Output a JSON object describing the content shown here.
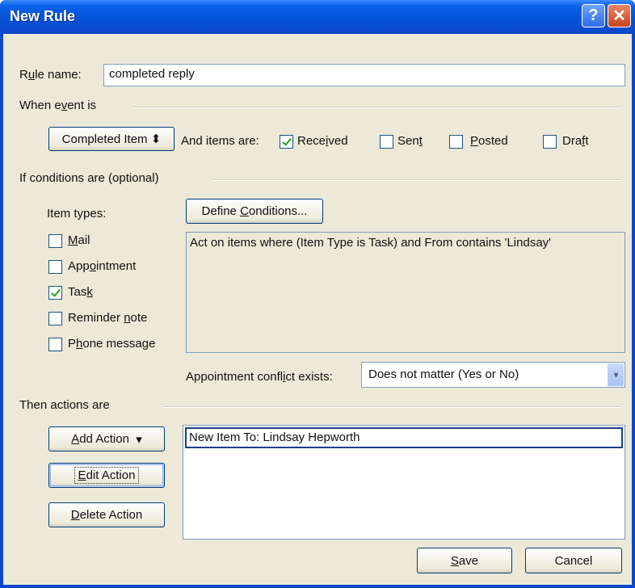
{
  "window": {
    "title": "New Rule",
    "help_glyph": "?",
    "close_glyph": "✕"
  },
  "rule_name": {
    "label_prefix": "R",
    "label_u": "u",
    "label_rest": "le name:",
    "value": "completed reply"
  },
  "when_event": {
    "heading_a": "When e",
    "heading_u": "v",
    "heading_b": "ent is",
    "event_value": "Completed Item",
    "event_arrow": "⬍",
    "and_items_label": "And items are:",
    "checkboxes": [
      {
        "pre": "Rece",
        "u": "i",
        "post": "ved",
        "checked": true
      },
      {
        "pre": "Sen",
        "u": "t",
        "post": "",
        "checked": false
      },
      {
        "pre": "",
        "u": "P",
        "post": "osted",
        "checked": false
      },
      {
        "pre": "Dra",
        "u": "f",
        "post": "t",
        "checked": false
      }
    ]
  },
  "conditions": {
    "heading": "If conditions are  (optional)",
    "item_types_label": "Item types:",
    "define_btn_pre": "Define ",
    "define_btn_u": "C",
    "define_btn_post": "onditions...",
    "description": "Act on items where (Item Type is Task) and From  contains 'Lindsay'",
    "item_types": [
      {
        "pre": "",
        "u": "M",
        "post": "ail",
        "checked": false
      },
      {
        "pre": "App",
        "u": "o",
        "post": "intment",
        "checked": false
      },
      {
        "pre": "Tas",
        "u": "k",
        "post": "",
        "checked": true
      },
      {
        "pre": "Reminder ",
        "u": "n",
        "post": "ote",
        "checked": false
      },
      {
        "pre": "P",
        "u": "h",
        "post": "one message",
        "checked": false
      }
    ],
    "conflict_label_pre": "Appointment confl",
    "conflict_label_u": "i",
    "conflict_label_post": "ct exists:",
    "conflict_value": "Does not matter (Yes or No)",
    "conflict_arrow": "▾"
  },
  "actions": {
    "heading": "Then actions are",
    "add_pre": "",
    "add_u": "A",
    "add_post": "dd Action",
    "add_arrow": "▾",
    "edit_pre": "",
    "edit_u": "E",
    "edit_post": "dit Action",
    "delete_pre": "",
    "delete_u": "D",
    "delete_post": "elete Action",
    "list": [
      "New Item To: Lindsay Hepworth"
    ]
  },
  "footer": {
    "save_pre": "",
    "save_u": "S",
    "save_post": "ave",
    "cancel_label": "Cancel"
  },
  "colors": {
    "titlebar": "#0553d8",
    "client": "#ece9d8",
    "check": "#21a121"
  }
}
